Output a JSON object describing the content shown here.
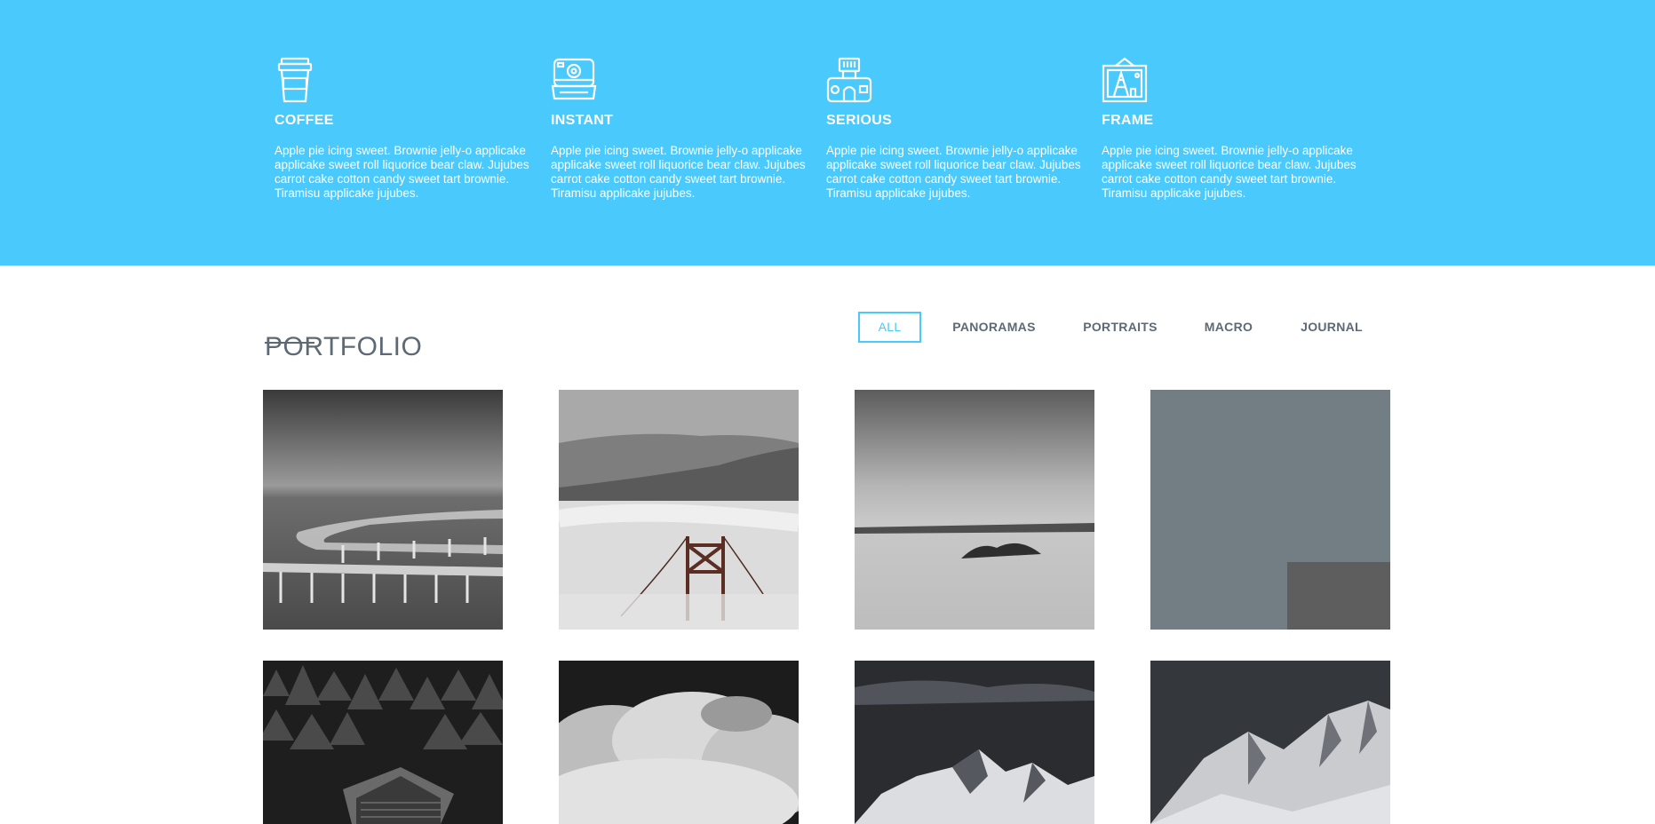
{
  "features": [
    {
      "icon": "coffee-cup-icon",
      "title": "COFFEE",
      "text": "Apple pie icing sweet. Brownie jelly-o applicake applicake sweet roll liquorice bear claw. Jujubes carrot cake cotton candy sweet tart brownie. Tiramisu applicake jujubes."
    },
    {
      "icon": "instant-camera-icon",
      "title": "INSTANT",
      "text": "Apple pie icing sweet. Brownie jelly-o applicake applicake sweet roll liquorice bear claw. Jujubes carrot cake cotton candy sweet tart brownie. Tiramisu applicake jujubes."
    },
    {
      "icon": "serious-camera-icon",
      "title": "SERIOUS",
      "text": "Apple pie icing sweet. Brownie jelly-o applicake applicake sweet roll liquorice bear claw. Jujubes carrot cake cotton candy sweet tart brownie. Tiramisu applicake jujubes."
    },
    {
      "icon": "picture-frame-icon",
      "title": "FRAME",
      "text": "Apple pie icing sweet. Brownie jelly-o applicake applicake sweet roll liquorice bear claw. Jujubes carrot cake cotton candy sweet tart brownie. Tiramisu applicake jujubes."
    }
  ],
  "portfolio": {
    "title": "PORTFOLIO",
    "filters": [
      {
        "label": "ALL",
        "active": true
      },
      {
        "label": "PANORAMAS",
        "active": false
      },
      {
        "label": "PORTRAITS",
        "active": false
      },
      {
        "label": "MACRO",
        "active": false
      },
      {
        "label": "JOURNAL",
        "active": false
      }
    ]
  },
  "colors": {
    "hero_background": "#4ac9fd",
    "heading_text": "#5d6a75",
    "active_filter": "#4ac9fd",
    "placeholder_tile": "#737d84"
  }
}
